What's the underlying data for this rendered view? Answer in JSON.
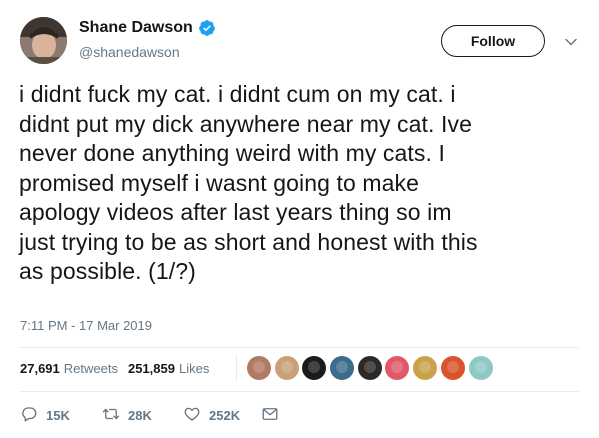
{
  "user": {
    "display_name": "Shane Dawson",
    "handle": "@shanedawson",
    "verified": true
  },
  "follow_button": "Follow",
  "tweet": {
    "lines": [
      "i didnt fuck my cat. i didnt cum on my cat. i",
      "didnt put my dick anywhere near my cat. Ive",
      "never done anything weird with my cats. I",
      "promised myself i wasnt going to make",
      "apology videos after last years thing so im",
      "just trying to be as short and honest with this",
      "as possible. (1/?)"
    ],
    "timestamp": "7:11 PM - 17 Mar 2019"
  },
  "stats": {
    "retweets_count": "27,691",
    "retweets_label": "Retweets",
    "likes_count": "251,859",
    "likes_label": "Likes"
  },
  "likers": [
    {
      "name": "liker-1",
      "color": "#b07a63"
    },
    {
      "name": "liker-2",
      "color": "#c9a07a"
    },
    {
      "name": "liker-3",
      "color": "#1b1b1b"
    },
    {
      "name": "liker-4",
      "color": "#3d6b8c"
    },
    {
      "name": "liker-5",
      "color": "#2a2a2a"
    },
    {
      "name": "liker-6",
      "color": "#e2586b"
    },
    {
      "name": "liker-7",
      "color": "#caa24a"
    },
    {
      "name": "liker-8",
      "color": "#d9532b"
    },
    {
      "name": "liker-9",
      "color": "#8fc9c4"
    }
  ],
  "actions": {
    "reply_count": "15K",
    "retweet_count": "28K",
    "like_count": "252K",
    "reply_icon": "reply-icon",
    "retweet_icon": "retweet-icon",
    "like_icon": "heart-icon",
    "dm_icon": "envelope-icon"
  },
  "colors": {
    "verified_blue": "#1da1f2",
    "secondary_text": "#657786",
    "divider": "#e6ecf0"
  }
}
